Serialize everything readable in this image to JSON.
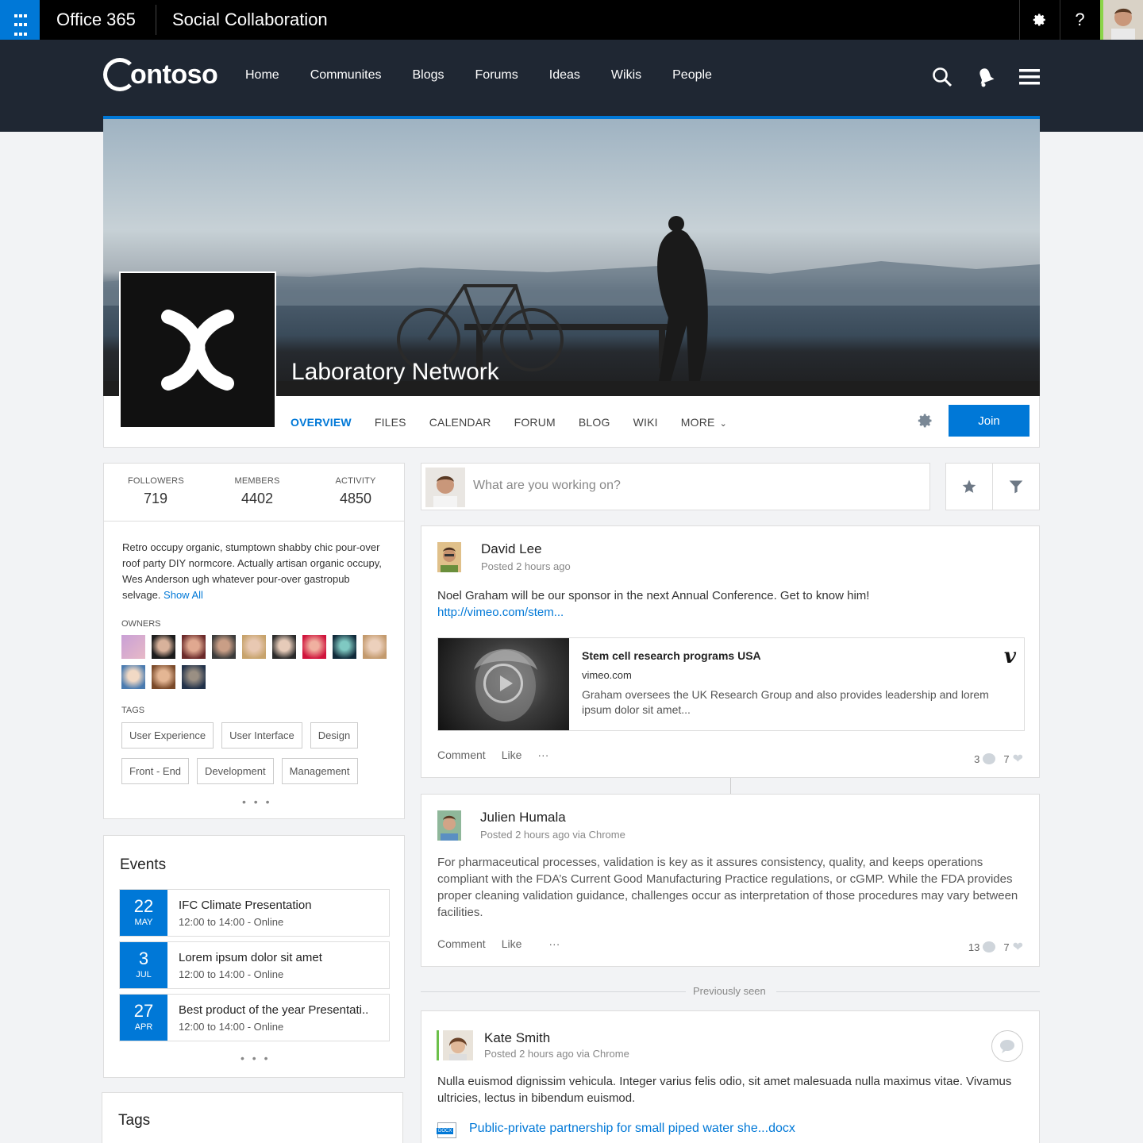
{
  "suite": {
    "title": "Office 365",
    "app": "Social Collaboration",
    "settings_icon": "gear-icon",
    "help_label": "?"
  },
  "brand": {
    "logo_text": "ontoso"
  },
  "nav": {
    "links": [
      "Home",
      "Communites",
      "Blogs",
      "Forums",
      "Ideas",
      "Wikis",
      "People"
    ]
  },
  "group": {
    "name": "Laboratory Network",
    "tabs": [
      "OVERVIEW",
      "FILES",
      "CALENDAR",
      "FORUM",
      "BLOG",
      "WIKI",
      "MORE"
    ],
    "active_tab": "OVERVIEW",
    "join_label": "Join",
    "accent": "#0078d7"
  },
  "stats": [
    {
      "label": "FOLLOWERS",
      "value": "719"
    },
    {
      "label": "MEMBERS",
      "value": "4402"
    },
    {
      "label": "ACTIVITY",
      "value": "4850"
    }
  ],
  "about": {
    "text": "Retro occupy organic, stumptown shabby chic pour-over roof party DIY normcore. Actually artisan organic occupy, Wes Anderson ugh whatever pour-over gastropub selvage.",
    "show_all": "Show All"
  },
  "owners_label": "OWNERS",
  "tags_label": "TAGS",
  "tags": [
    "User Experience",
    "User Interface",
    "Design",
    "Front - End",
    "Development",
    "Management"
  ],
  "events": {
    "title": "Events",
    "items": [
      {
        "day": "22",
        "month": "MAY",
        "title": "IFC Climate Presentation",
        "time": "12:00 to 14:00 - Online"
      },
      {
        "day": "3",
        "month": "JUL",
        "title": "Lorem ipsum dolor sit amet",
        "time": "12:00 to 14:00 - Online"
      },
      {
        "day": "27",
        "month": "APR",
        "title": "Best product of the year Presentati..",
        "time": "12:00 to 14:00 - Online"
      }
    ]
  },
  "tags_card": {
    "title": "Tags"
  },
  "composer": {
    "placeholder": "What are you working on?"
  },
  "posts": [
    {
      "author": "David Lee",
      "meta": "Posted 2 hours ago",
      "body": "Noel Graham will be our sponsor in the next Annual Conference. Get to know him!",
      "link": "http://vimeo.com/stem...",
      "embed": {
        "title": "Stem cell research programs USA",
        "site": "vimeo.com",
        "desc": "Graham oversees the UK Research Group and also provides leadership and lorem ipsum dolor sit amet...",
        "badge": "v"
      },
      "actions": [
        "Comment",
        "Like",
        "···"
      ],
      "comments": "3",
      "likes": "7"
    },
    {
      "author": "Julien Humala",
      "meta": "Posted 2 hours ago via Chrome",
      "body": "For pharmaceutical processes, validation is key as it assures consistency, quality, and keeps operations compliant with the FDA’s Current Good Manufacturing Practice regulations, or cGMP. While the FDA provides proper cleaning validation guidance, challenges occur as interpretation of those procedures may vary between facilities.",
      "actions": [
        "Comment",
        "Like",
        "···"
      ],
      "comments": "13",
      "likes": "7"
    },
    {
      "author": "Kate Smith",
      "meta": "Posted 2 hours ago via Chrome",
      "body": "Nulla euismod dignissim vehicula. Integer varius felis odio, sit amet malesuada nulla maximus vitae. Vivamus ultricies, lectus in bibendum euismod.",
      "attachment": "Public-private partnership for small piped water she...docx"
    }
  ],
  "previously_seen": "Previously seen",
  "more_dots": "• • •"
}
